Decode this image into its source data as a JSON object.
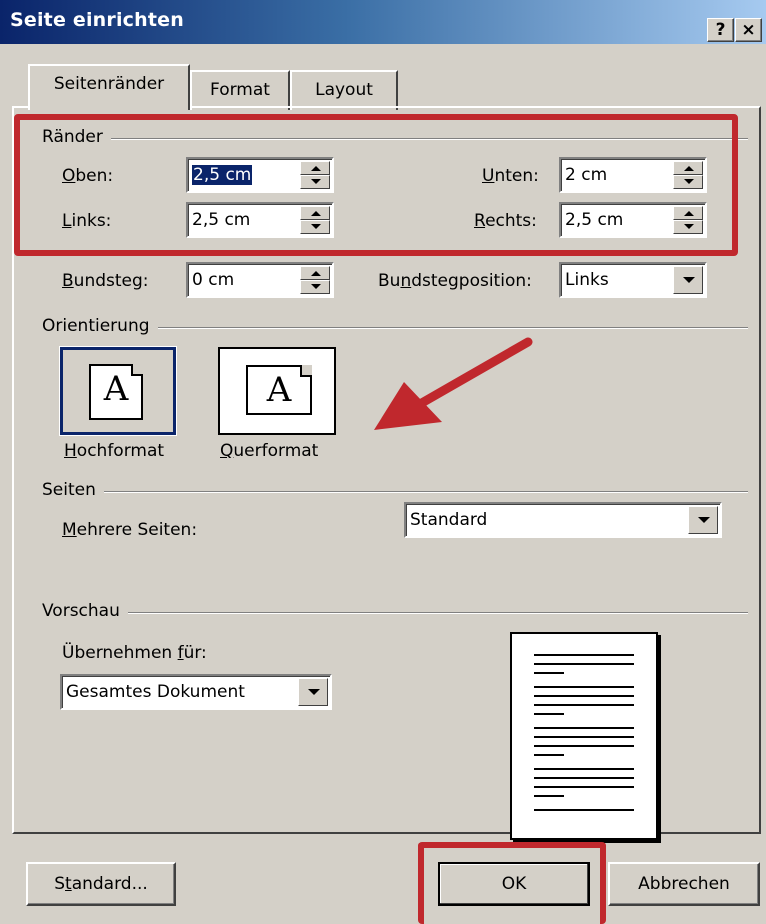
{
  "window": {
    "title": "Seite einrichten",
    "help_glyph": "?",
    "close_glyph": "×"
  },
  "tabs": [
    {
      "label": "Seitenränder",
      "active": true
    },
    {
      "label": "Format",
      "active": false
    },
    {
      "label": "Layout",
      "active": false
    }
  ],
  "margins": {
    "group_label": "Ränder",
    "top": {
      "label": "Oben:",
      "value": "2,5 cm"
    },
    "bottom": {
      "label": "Unten:",
      "value": "2 cm"
    },
    "left": {
      "label": "Links:",
      "value": "2,5 cm"
    },
    "right": {
      "label": "Rechts:",
      "value": "2,5 cm"
    },
    "gutter": {
      "label": "Bundsteg:",
      "value": "0 cm"
    },
    "gutter_position": {
      "label": "Bundstegposition:",
      "value": "Links"
    }
  },
  "orientation": {
    "group_label": "Orientierung",
    "portrait_label": "Hochformat",
    "landscape_label": "Querformat",
    "icon_letter": "A",
    "selected": "portrait"
  },
  "pages": {
    "group_label": "Seiten",
    "multiple_label": "Mehrere Seiten:",
    "multiple_value": "Standard"
  },
  "preview": {
    "group_label": "Vorschau",
    "apply_label": "Übernehmen für:",
    "apply_value": "Gesamtes Dokument"
  },
  "buttons": {
    "default_label": "Standard...",
    "ok_label": "OK",
    "cancel_label": "Abbrechen"
  },
  "annotation_color": "#c0282d"
}
